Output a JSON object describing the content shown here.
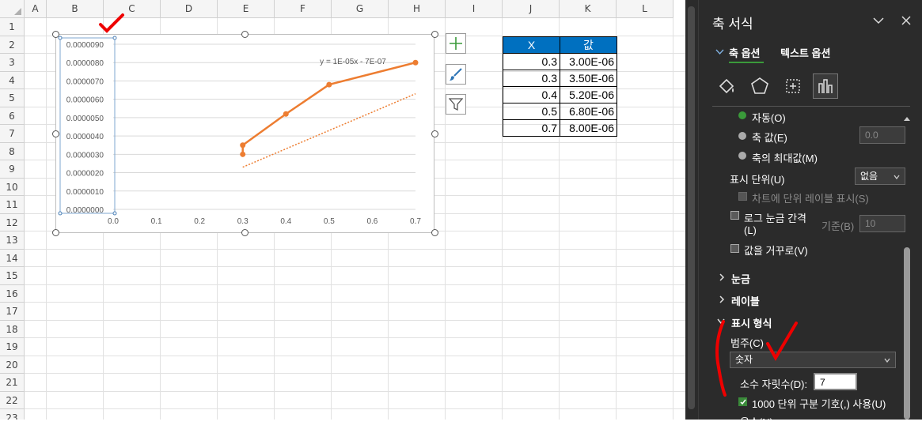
{
  "sheet": {
    "columns": [
      "A",
      "B",
      "C",
      "D",
      "E",
      "F",
      "G",
      "H",
      "I",
      "J",
      "K",
      "L"
    ],
    "rows": [
      "1",
      "2",
      "3",
      "4",
      "5",
      "6",
      "7",
      "8",
      "9",
      "10",
      "11",
      "12",
      "13",
      "14",
      "15",
      "16",
      "17",
      "18",
      "19",
      "20",
      "21",
      "22",
      "23"
    ]
  },
  "chart_data": {
    "type": "scatter",
    "x": [
      0.3,
      0.3,
      0.4,
      0.5,
      0.7
    ],
    "y": [
      3e-06,
      3.5e-06,
      5.2e-06,
      6.8e-06,
      8e-06
    ],
    "xlim": [
      0,
      0.7
    ],
    "ylim": [
      0,
      9e-06
    ],
    "xticks": [
      "0.0",
      "0.1",
      "0.2",
      "0.3",
      "0.4",
      "0.5",
      "0.6",
      "0.7"
    ],
    "yticks": [
      "0.0000000",
      "0.0000010",
      "0.0000020",
      "0.0000030",
      "0.0000040",
      "0.0000050",
      "0.0000060",
      "0.0000070",
      "0.0000080",
      "0.0000090"
    ],
    "x_axis_top_label": "0.0",
    "trendline_label": "y = 1E-05x - 7E-07",
    "series_color": "#ed7d31",
    "grid": true
  },
  "table": {
    "headers": [
      "X",
      "값"
    ],
    "rows": [
      [
        "0.3",
        "3.00E-06"
      ],
      [
        "0.3",
        "3.50E-06"
      ],
      [
        "0.4",
        "5.20E-06"
      ],
      [
        "0.5",
        "6.80E-06"
      ],
      [
        "0.7",
        "8.00E-06"
      ]
    ],
    "header_color": "#0070c0"
  },
  "pane": {
    "title": "축 서식",
    "tab_axis": "축 옵션",
    "tab_text": "텍스트 옵션",
    "radio_auto": "자동(O)",
    "radio_axis_value": "축 값(E)",
    "axis_value": "0.0",
    "radio_max": "축의 최대값(M)",
    "display_units_label": "표시 단위(U)",
    "display_units_value": "없음",
    "show_units_label": "차트에 단위 레이블 표시(S)",
    "log_scale_label": "로그 눈금 간격",
    "log_scale_label2": "(L)",
    "base_label": "기준(B)",
    "base_value": "10",
    "reverse_label": "값을 거꾸로(V)",
    "sec_ticks": "눈금",
    "sec_labels": "레이블",
    "sec_number": "표시 형식",
    "category_label": "범주(C)",
    "category_value": "숫자",
    "decimals_label": "소수 자릿수(D):",
    "decimals_value": "7",
    "thousands_label": "1000 단위 구분 기호(,) 사용(U)",
    "cut_label": "음수(N)"
  }
}
